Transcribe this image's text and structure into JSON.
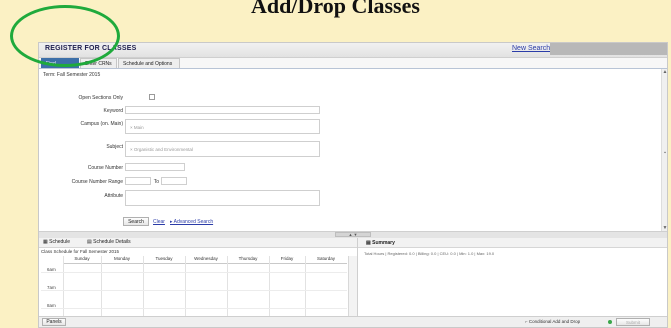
{
  "heading": "Add/Drop Classes",
  "app": {
    "title": "REGISTER FOR CLASSES",
    "new_search": "New Search",
    "tabs": [
      "Find Classes",
      "Enter CRNs",
      "Schedule and Options"
    ]
  },
  "form": {
    "term": "Term: Fall Semester 2015",
    "open_sections_label": "Open Sections Only",
    "keyword_label": "Keyword",
    "campus_label": "Campus (on. Main)",
    "campus_chip": "× Main",
    "subject_label": "Subject",
    "subject_chip": "× Organistic and Environmental",
    "course_number_label": "Course Number",
    "course_range_label": "Course Number Range",
    "to_label": "To",
    "attribute_label": "Attribute",
    "search_button": "Search",
    "clear_link": "Clear",
    "advanced_link": "▸ Advanced Search"
  },
  "schedule": {
    "tabs": [
      "Schedule",
      "Schedule Details"
    ],
    "title": "Class Schedule for Fall Semester 2015",
    "days": [
      "Sunday",
      "Monday",
      "Tuesday",
      "Wednesday",
      "Thursday",
      "Friday",
      "Saturday"
    ],
    "times": [
      "6am",
      "7am",
      "8am"
    ]
  },
  "summary": {
    "title": "Summary",
    "line": "Total Hours | Registered: 0.0 | Billing: 0.0 | CEU: 0.0 | Min: 1.0 | Max: 19.0"
  },
  "footer": {
    "panels_button": "Panels",
    "conditional_label": "Conditional Add and Drop",
    "submit_button": "Submit"
  },
  "colors": {
    "page_background": "#fbf1c4",
    "active_tab": "#3d6fa8",
    "highlight_circle": "#1faa3c",
    "link": "#2b3ca8"
  }
}
